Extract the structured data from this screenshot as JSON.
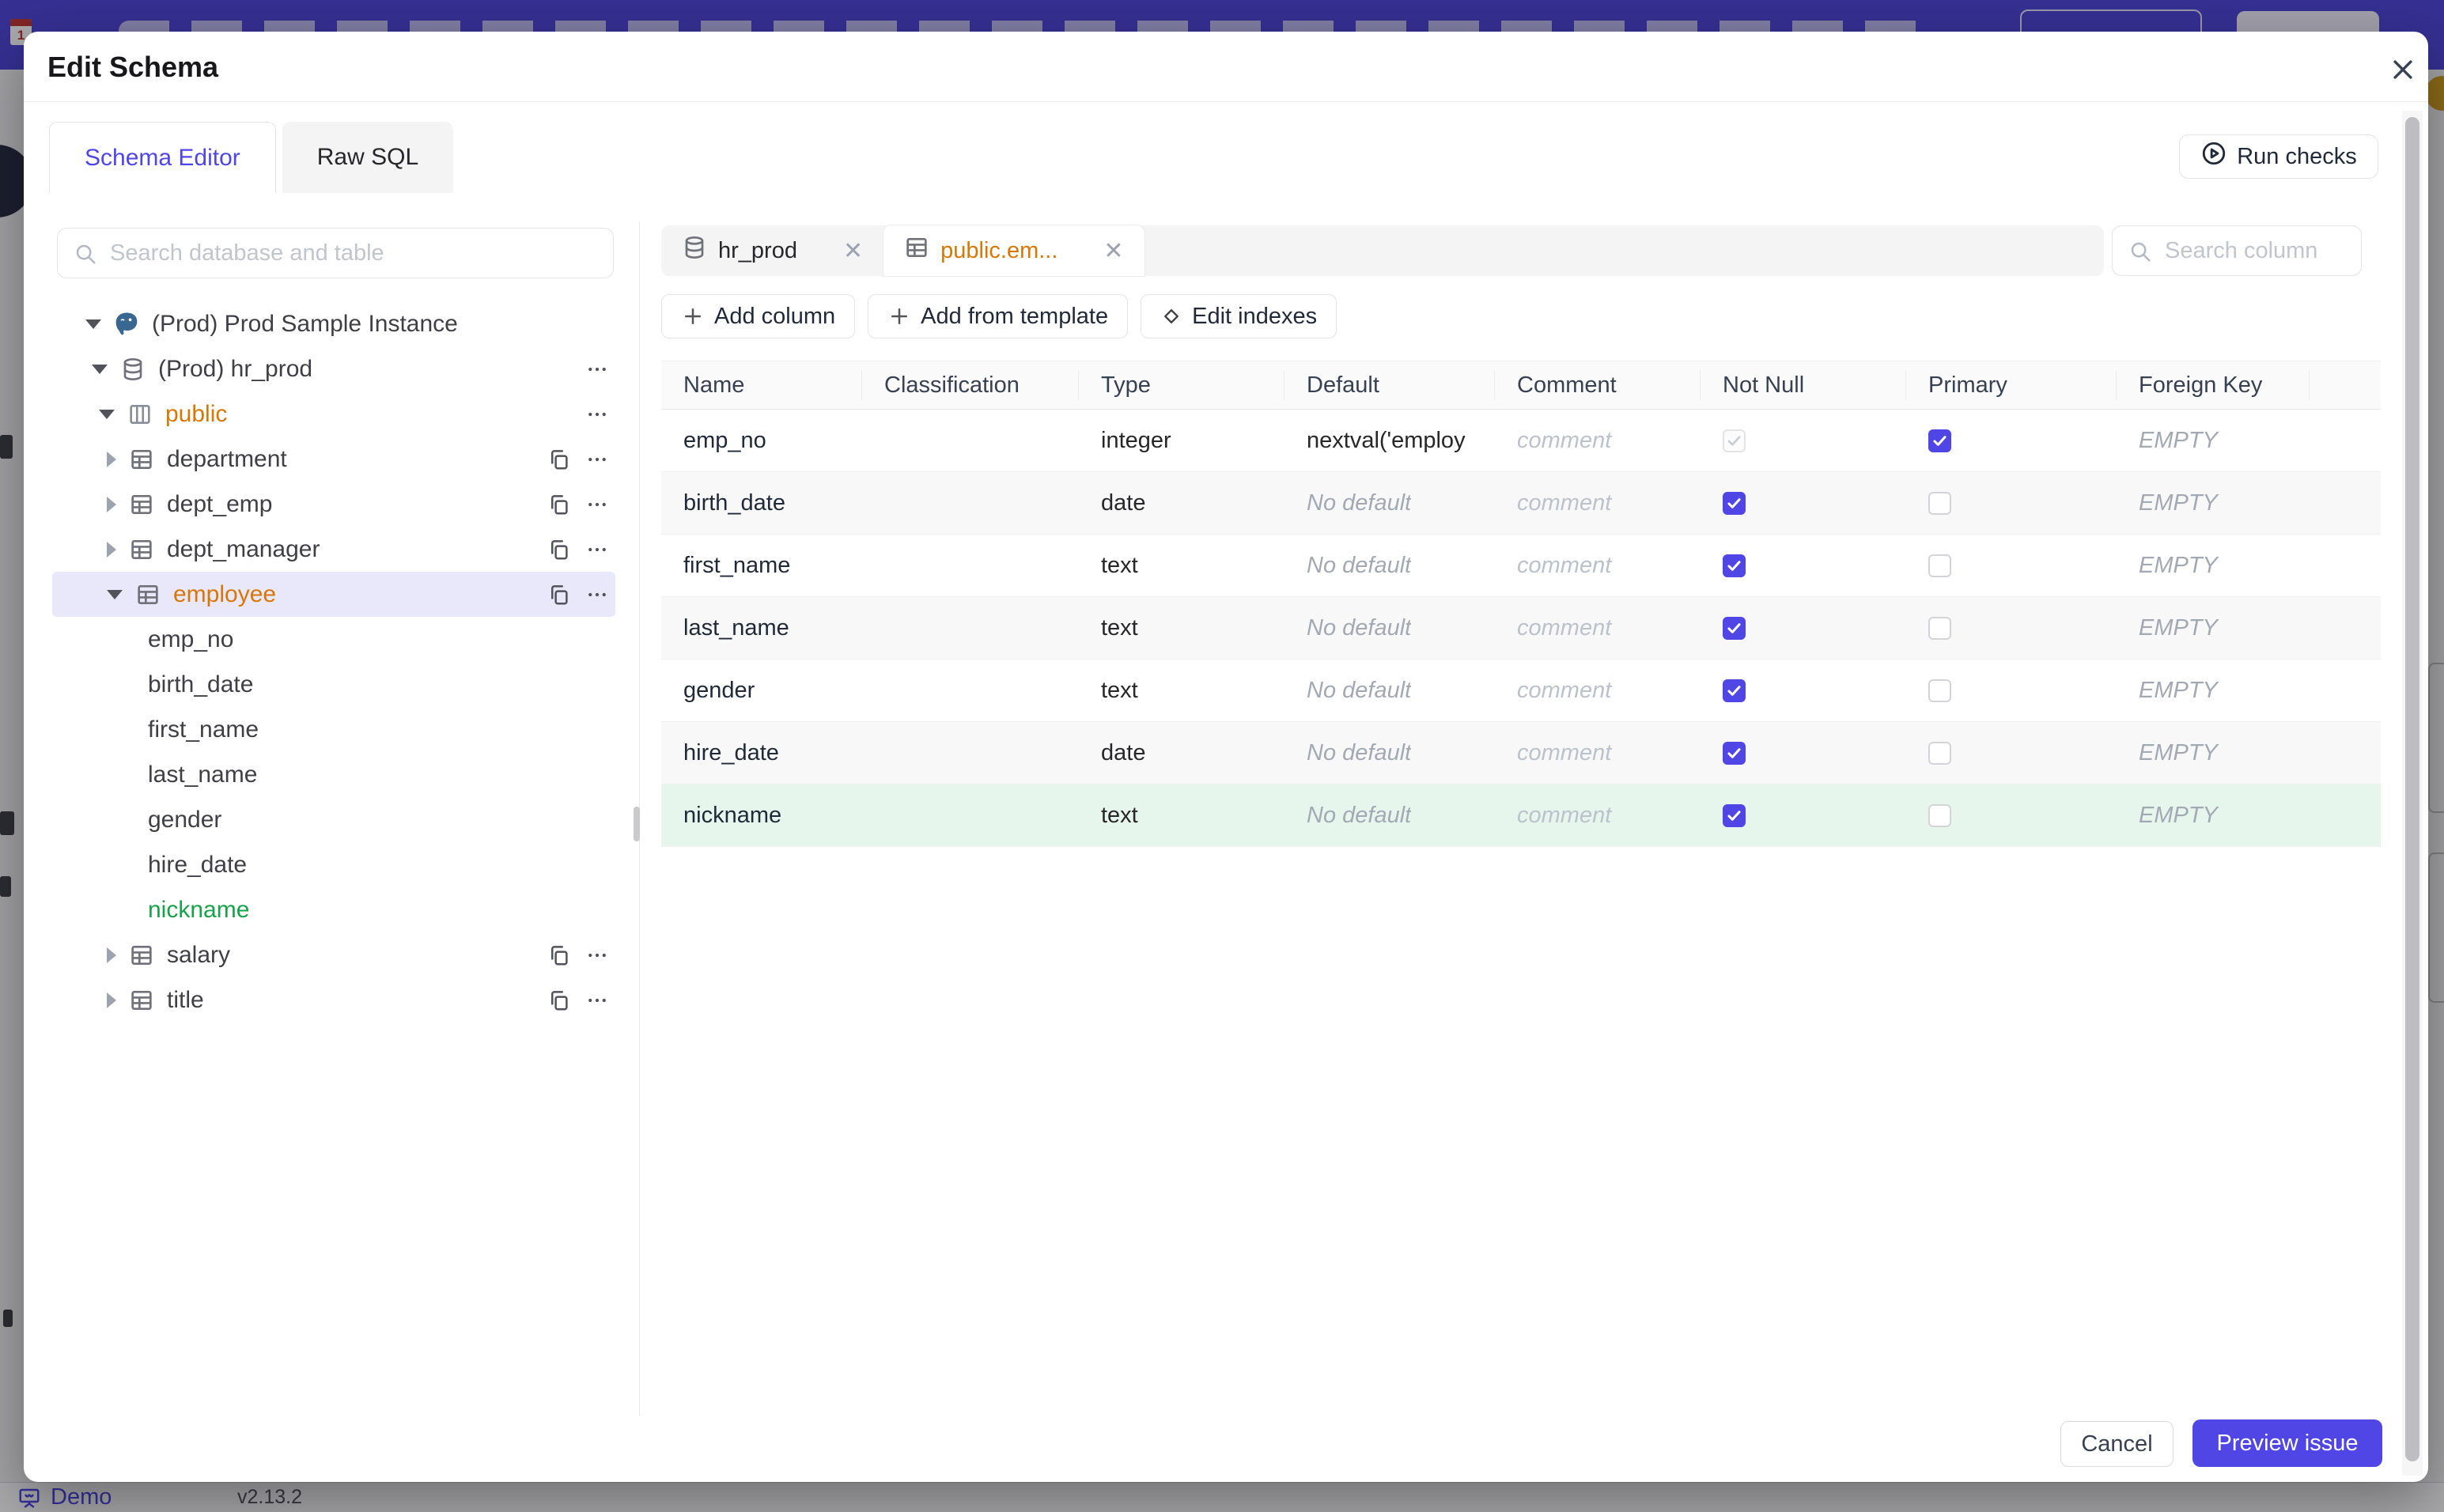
{
  "backdrop": {
    "bottom_bar": {
      "demo_label": "Demo",
      "version": "v2.13.2"
    },
    "calendar_day": "1"
  },
  "modal": {
    "title": "Edit Schema",
    "tabs": [
      {
        "label": "Schema Editor"
      },
      {
        "label": "Raw SQL"
      }
    ],
    "run_checks": {
      "label": "Run checks"
    },
    "sidebar": {
      "search_placeholder": "Search database and table",
      "tree": [
        {
          "label": "(Prod) Prod Sample Instance",
          "type": "instance",
          "depth": 0,
          "caret": "down",
          "icon": "postgres",
          "actions": []
        },
        {
          "label": "(Prod) hr_prod",
          "type": "database",
          "depth": 1,
          "caret": "down",
          "icon": "database",
          "actions": [
            "more"
          ]
        },
        {
          "label": "public",
          "type": "schema",
          "depth": 2,
          "caret": "down",
          "icon": "schema",
          "color": "orange",
          "actions": [
            "more"
          ]
        },
        {
          "label": "department",
          "type": "table",
          "depth": 3,
          "caret": "right",
          "icon": "table",
          "actions": [
            "copy",
            "more"
          ]
        },
        {
          "label": "dept_emp",
          "type": "table",
          "depth": 3,
          "caret": "right",
          "icon": "table",
          "actions": [
            "copy",
            "more"
          ]
        },
        {
          "label": "dept_manager",
          "type": "table",
          "depth": 3,
          "caret": "right",
          "icon": "table",
          "actions": [
            "copy",
            "more"
          ]
        },
        {
          "label": "employee",
          "type": "table",
          "depth": 3,
          "caret": "down",
          "icon": "table",
          "color": "orange",
          "selected": true,
          "actions": [
            "copy",
            "more"
          ]
        },
        {
          "label": "emp_no",
          "type": "column",
          "depth": 4
        },
        {
          "label": "birth_date",
          "type": "column",
          "depth": 4
        },
        {
          "label": "first_name",
          "type": "column",
          "depth": 4
        },
        {
          "label": "last_name",
          "type": "column",
          "depth": 4
        },
        {
          "label": "gender",
          "type": "column",
          "depth": 4
        },
        {
          "label": "hire_date",
          "type": "column",
          "depth": 4
        },
        {
          "label": "nickname",
          "type": "column",
          "depth": 4,
          "color": "green"
        },
        {
          "label": "salary",
          "type": "table",
          "depth": 3,
          "caret": "right",
          "icon": "table",
          "actions": [
            "copy",
            "more"
          ]
        },
        {
          "label": "title",
          "type": "table",
          "depth": 3,
          "caret": "right",
          "icon": "table",
          "actions": [
            "copy",
            "more"
          ]
        }
      ]
    },
    "editor": {
      "open_tabs": [
        {
          "label": "hr_prod",
          "icon": "database",
          "active": false
        },
        {
          "label": "public.em...",
          "icon": "table",
          "active": true
        }
      ],
      "toolbar": [
        {
          "label": "Add column",
          "icon": "plus"
        },
        {
          "label": "Add from template",
          "icon": "plus"
        },
        {
          "label": "Edit indexes",
          "icon": "diamond"
        }
      ],
      "search_placeholder": "Search column",
      "table": {
        "headers": [
          "Name",
          "Classification",
          "Type",
          "Default",
          "Comment",
          "Not Null",
          "Primary",
          "Foreign Key"
        ],
        "comment_placeholder": "comment",
        "foreign_key_value": "EMPTY",
        "rows": [
          {
            "name": "emp_no",
            "type": "integer",
            "default": "nextval('employ",
            "default_is_placeholder": false,
            "not_null": "checked-disabled",
            "primary": true,
            "highlight": false
          },
          {
            "name": "birth_date",
            "type": "date",
            "default": "No default",
            "default_is_placeholder": true,
            "not_null": "checked",
            "primary": false,
            "highlight": false
          },
          {
            "name": "first_name",
            "type": "text",
            "default": "No default",
            "default_is_placeholder": true,
            "not_null": "checked",
            "primary": false,
            "highlight": false
          },
          {
            "name": "last_name",
            "type": "text",
            "default": "No default",
            "default_is_placeholder": true,
            "not_null": "checked",
            "primary": false,
            "highlight": false
          },
          {
            "name": "gender",
            "type": "text",
            "default": "No default",
            "default_is_placeholder": true,
            "not_null": "checked",
            "primary": false,
            "highlight": false
          },
          {
            "name": "hire_date",
            "type": "date",
            "default": "No default",
            "default_is_placeholder": true,
            "not_null": "checked",
            "primary": false,
            "highlight": false
          },
          {
            "name": "nickname",
            "type": "text",
            "default": "No default",
            "default_is_placeholder": true,
            "not_null": "checked",
            "primary": false,
            "highlight": true
          }
        ]
      }
    },
    "footer": {
      "cancel_label": "Cancel",
      "submit_label": "Preview issue"
    },
    "colors": {
      "accent": "#4f46e5",
      "schema_highlight": "#d97706",
      "new_item_green": "#16a34a",
      "row_highlight_bg": "#e7f6ed",
      "selected_tree_bg": "#e9e8fb"
    }
  }
}
